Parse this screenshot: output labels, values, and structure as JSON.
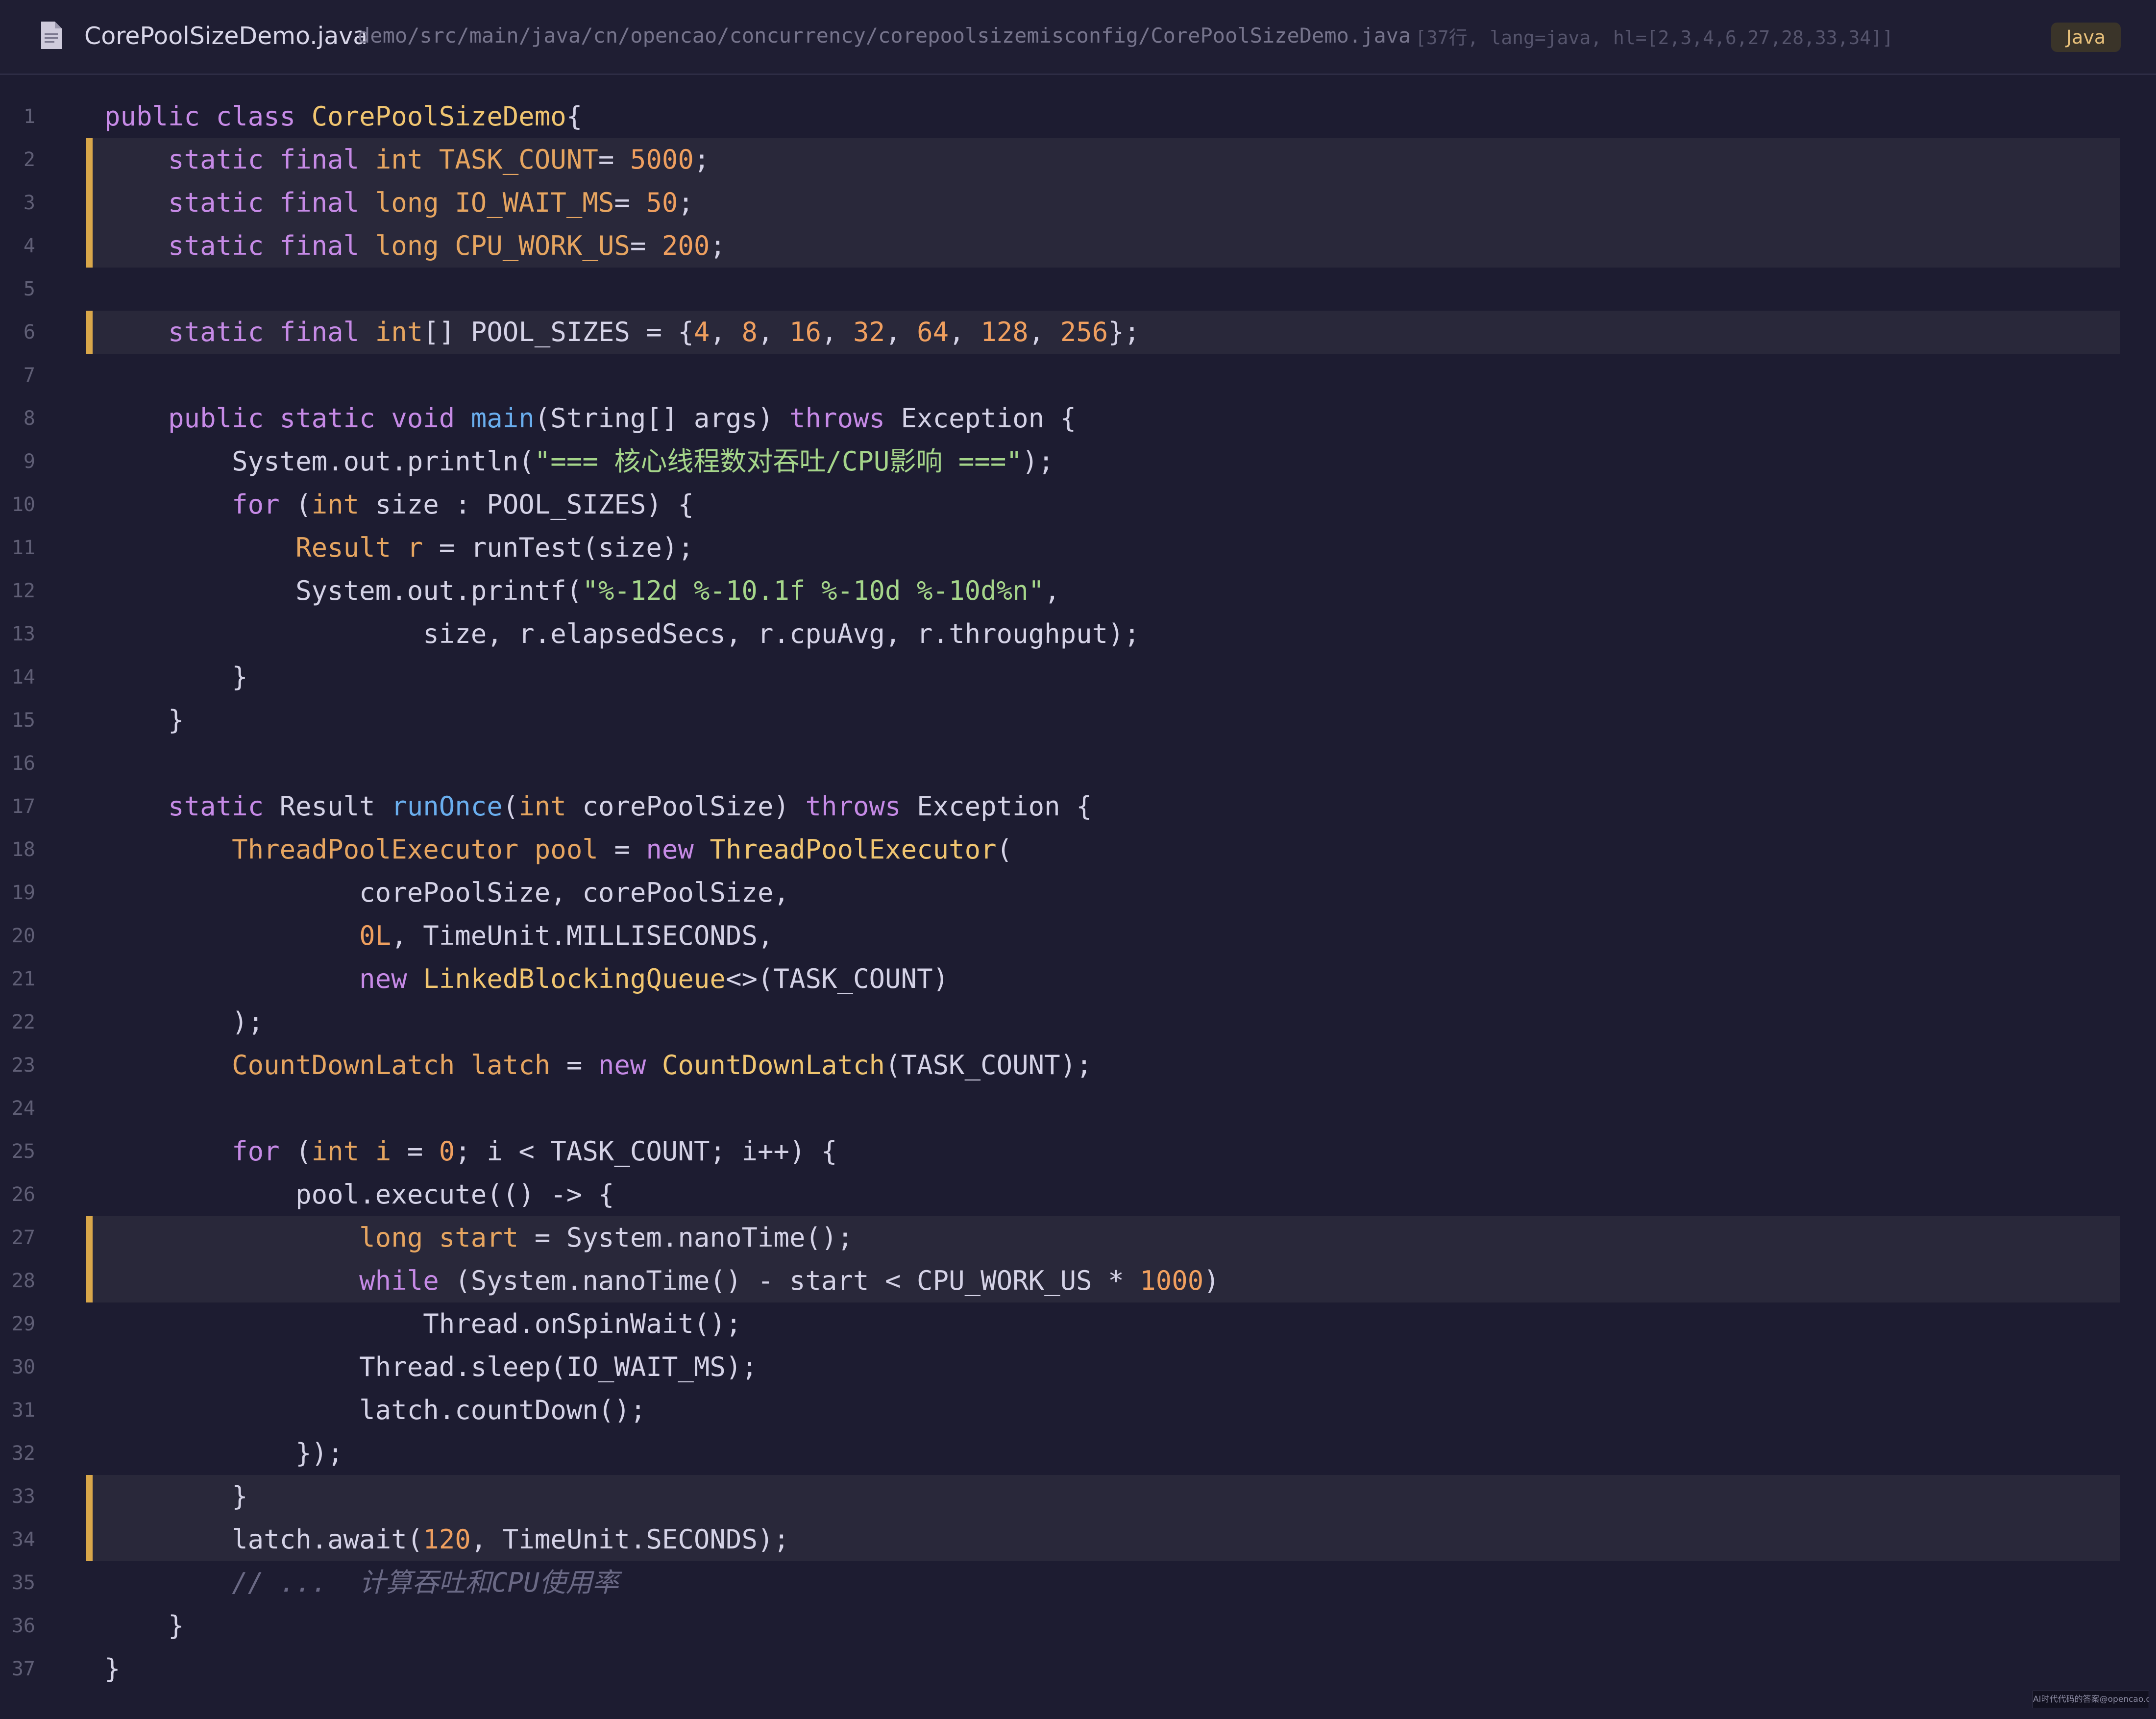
{
  "header": {
    "file_name": "CorePoolSizeDemo.java",
    "file_path": "demo/src/main/java/cn/opencao/concurrency/corepoolsizemisconfig/CorePoolSizeDemo.java",
    "meta": "[37行, lang=java, hl=[2,3,4,6,27,28,33,34]]",
    "language": "Java",
    "icon": "document-icon"
  },
  "code": {
    "highlighted_lines": [
      2,
      3,
      4,
      6,
      27,
      28,
      33,
      34
    ],
    "highlight_color": "#d9a74a",
    "lines": [
      [
        [
          "kw",
          "public class "
        ],
        [
          "cls",
          "CorePoolSizeDemo"
        ],
        [
          "",
          "{"
        ]
      ],
      [
        [
          "kw",
          "    static final "
        ],
        [
          "ty",
          "int "
        ],
        [
          "ty",
          "TASK_COUNT"
        ],
        [
          "",
          "= "
        ],
        [
          "num",
          "5000"
        ],
        [
          "",
          ";"
        ]
      ],
      [
        [
          "kw",
          "    static final "
        ],
        [
          "ty",
          "long "
        ],
        [
          "ty",
          "IO_WAIT_MS"
        ],
        [
          "",
          "= "
        ],
        [
          "num",
          "50"
        ],
        [
          "",
          ";"
        ]
      ],
      [
        [
          "kw",
          "    static final "
        ],
        [
          "ty",
          "long "
        ],
        [
          "ty",
          "CPU_WORK_US"
        ],
        [
          "",
          "= "
        ],
        [
          "num",
          "200"
        ],
        [
          "",
          ";"
        ]
      ],
      [],
      [
        [
          "kw",
          "    static final "
        ],
        [
          "ty",
          "int"
        ],
        [
          "",
          "[] POOL_SIZES = {"
        ],
        [
          "num",
          "4"
        ],
        [
          "",
          ", "
        ],
        [
          "num",
          "8"
        ],
        [
          "",
          ", "
        ],
        [
          "num",
          "16"
        ],
        [
          "",
          ", "
        ],
        [
          "num",
          "32"
        ],
        [
          "",
          ", "
        ],
        [
          "num",
          "64"
        ],
        [
          "",
          ", "
        ],
        [
          "num",
          "128"
        ],
        [
          "",
          ", "
        ],
        [
          "num",
          "256"
        ],
        [
          "",
          "};"
        ]
      ],
      [],
      [
        [
          "kw",
          "    public static void "
        ],
        [
          "fn",
          "main"
        ],
        [
          "",
          "(String[] args) "
        ],
        [
          "kw",
          "throws "
        ],
        [
          "",
          "Exception {"
        ]
      ],
      [
        [
          "",
          "        System.out.println("
        ],
        [
          "str",
          "\"=== 核心线程数对吞吐/CPU影响 ===\""
        ],
        [
          "",
          ");"
        ]
      ],
      [
        [
          "kw",
          "        for "
        ],
        [
          "",
          "("
        ],
        [
          "ty",
          "int "
        ],
        [
          "",
          "size : POOL_SIZES) {"
        ]
      ],
      [
        [
          "ty",
          "            Result "
        ],
        [
          "ty",
          "r "
        ],
        [
          "",
          "= runTest(size);"
        ]
      ],
      [
        [
          "",
          "            System.out.printf("
        ],
        [
          "str",
          "\"%-12d %-10.1f %-10d %-10d%n\""
        ],
        [
          "",
          ","
        ]
      ],
      [
        [
          "",
          "                    size, r.elapsedSecs, r.cpuAvg, r.throughput);"
        ]
      ],
      [
        [
          "",
          "        }"
        ]
      ],
      [
        [
          "",
          "    }"
        ]
      ],
      [],
      [
        [
          "kw",
          "    static "
        ],
        [
          "",
          "Result "
        ],
        [
          "fn",
          "runOnce"
        ],
        [
          "",
          "("
        ],
        [
          "ty",
          "int "
        ],
        [
          "",
          "corePoolSize) "
        ],
        [
          "kw",
          "throws "
        ],
        [
          "",
          "Exception {"
        ]
      ],
      [
        [
          "ty",
          "        ThreadPoolExecutor "
        ],
        [
          "ty",
          "pool "
        ],
        [
          "",
          "= "
        ],
        [
          "kw",
          "new "
        ],
        [
          "cls",
          "ThreadPoolExecutor"
        ],
        [
          "",
          "("
        ]
      ],
      [
        [
          "",
          "                corePoolSize, corePoolSize,"
        ]
      ],
      [
        [
          "num",
          "                0L"
        ],
        [
          "",
          ", TimeUnit.MILLISECONDS,"
        ]
      ],
      [
        [
          "kw",
          "                new "
        ],
        [
          "cls",
          "LinkedBlockingQueue"
        ],
        [
          "",
          "<>(TASK_COUNT)"
        ]
      ],
      [
        [
          "",
          "        );"
        ]
      ],
      [
        [
          "ty",
          "        CountDownLatch "
        ],
        [
          "ty",
          "latch "
        ],
        [
          "",
          "= "
        ],
        [
          "kw",
          "new "
        ],
        [
          "cls",
          "CountDownLatch"
        ],
        [
          "",
          "(TASK_COUNT);"
        ]
      ],
      [],
      [
        [
          "kw",
          "        for "
        ],
        [
          "",
          "("
        ],
        [
          "ty",
          "int "
        ],
        [
          "ty",
          "i "
        ],
        [
          "",
          "= "
        ],
        [
          "num",
          "0"
        ],
        [
          "",
          "; i < TASK_COUNT; i++) {"
        ]
      ],
      [
        [
          "",
          "            pool.execute(() -> {"
        ]
      ],
      [
        [
          "ty",
          "                long "
        ],
        [
          "ty",
          "start "
        ],
        [
          "",
          "= System.nanoTime();"
        ]
      ],
      [
        [
          "kw",
          "                while "
        ],
        [
          "",
          "(System.nanoTime() - start < CPU_WORK_US * "
        ],
        [
          "num",
          "1000"
        ],
        [
          "",
          ")"
        ]
      ],
      [
        [
          "",
          "                    Thread.onSpinWait();"
        ]
      ],
      [
        [
          "",
          "                Thread.sleep(IO_WAIT_MS);"
        ]
      ],
      [
        [
          "",
          "                latch.countDown();"
        ]
      ],
      [
        [
          "",
          "            });"
        ]
      ],
      [
        [
          "",
          "        }"
        ]
      ],
      [
        [
          "",
          "        latch.await("
        ],
        [
          "num",
          "120"
        ],
        [
          "",
          ", TimeUnit.SECONDS);"
        ]
      ],
      [
        [
          "cm",
          "        // ...  计算吞吐和CPU使用率"
        ]
      ],
      [
        [
          "",
          "    }"
        ]
      ],
      [
        [
          "",
          "}"
        ]
      ]
    ]
  },
  "watermark": "AI时代代码的答案@opencao.cn"
}
